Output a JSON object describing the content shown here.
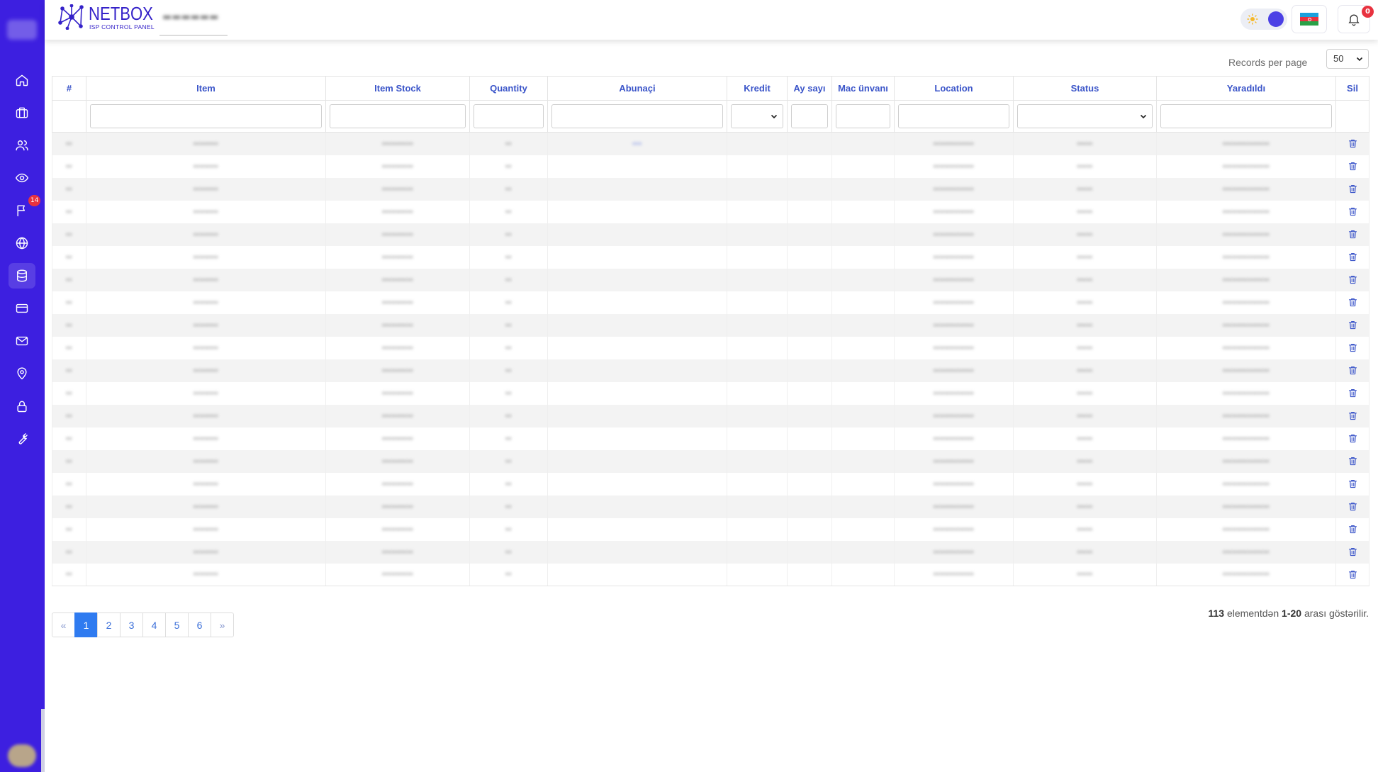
{
  "header": {
    "brand_name": "NETBOX",
    "brand_sub": "ISP CONTROL PANEL",
    "notification_count": "0",
    "language_flag": "azerbaijan-flag",
    "colors": {
      "sidebar": "#3d1fe0",
      "accent": "#3b55c9",
      "badge": "#e8323f",
      "toggle_knob": "#4b40e5"
    }
  },
  "sidebar": {
    "items": [
      {
        "icon": "home-icon"
      },
      {
        "icon": "briefcase-icon"
      },
      {
        "icon": "users-icon"
      },
      {
        "icon": "eye-icon"
      },
      {
        "icon": "flag-icon",
        "badge": "14"
      },
      {
        "icon": "globe-icon"
      },
      {
        "icon": "database-icon",
        "active": true
      },
      {
        "icon": "credit-card-icon"
      },
      {
        "icon": "mail-icon"
      },
      {
        "icon": "map-pin-icon"
      },
      {
        "icon": "lock-icon"
      },
      {
        "icon": "wrench-icon"
      }
    ]
  },
  "records_per_page": {
    "label": "Records per page",
    "value": "50"
  },
  "table": {
    "columns": [
      "#",
      "Item",
      "Item Stock",
      "Quantity",
      "Abunaçi",
      "Kredit",
      "Ay sayı",
      "Mac ünvanı",
      "Location",
      "Status",
      "Yaradıldı",
      "Sil"
    ],
    "row_count": 20
  },
  "pagination": {
    "prev": "«",
    "pages": [
      "1",
      "2",
      "3",
      "4",
      "5",
      "6"
    ],
    "active": "1",
    "next": "»"
  },
  "summary": {
    "total": "113",
    "mid": "elementdən",
    "range": "1-20",
    "suffix": "arası göstərilir."
  }
}
